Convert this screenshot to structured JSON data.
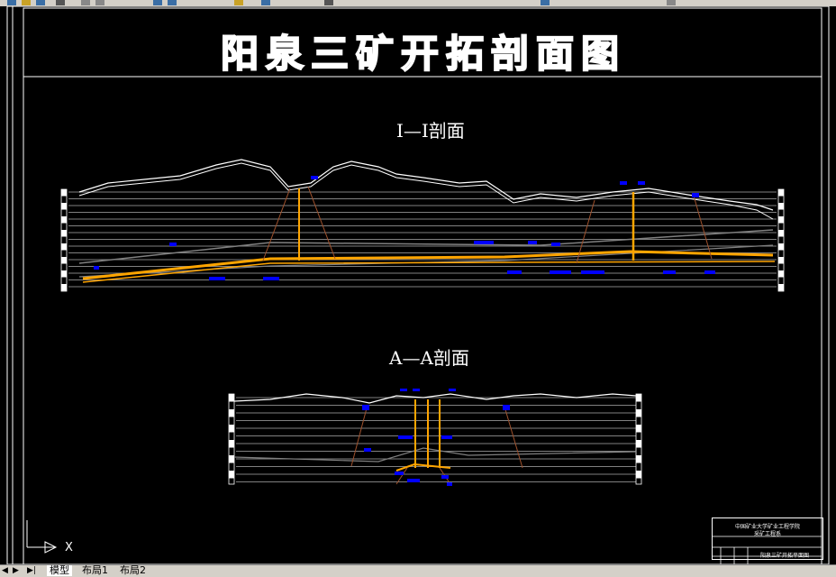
{
  "drawing": {
    "title": "阳泉三矿开拓剖面图",
    "section_1_label": "I—I剖面",
    "section_2_label": "A—A剖面"
  },
  "title_block": {
    "line1": "中国矿业大学矿业工程学院",
    "line2": "采矿工程系",
    "line3": "阳泉三矿开拓平面图"
  },
  "ucs": {
    "axis_label": "X"
  },
  "tabs": [
    {
      "label": "模型",
      "active": true
    },
    {
      "label": "布局1",
      "active": false
    },
    {
      "label": "布局2",
      "active": false
    }
  ],
  "colors": {
    "background": "#000000",
    "lines": "#ffffff",
    "shaft": "#ffa500",
    "labels": "#0000ff",
    "strata": "#808080",
    "fault": "#a0522d"
  }
}
